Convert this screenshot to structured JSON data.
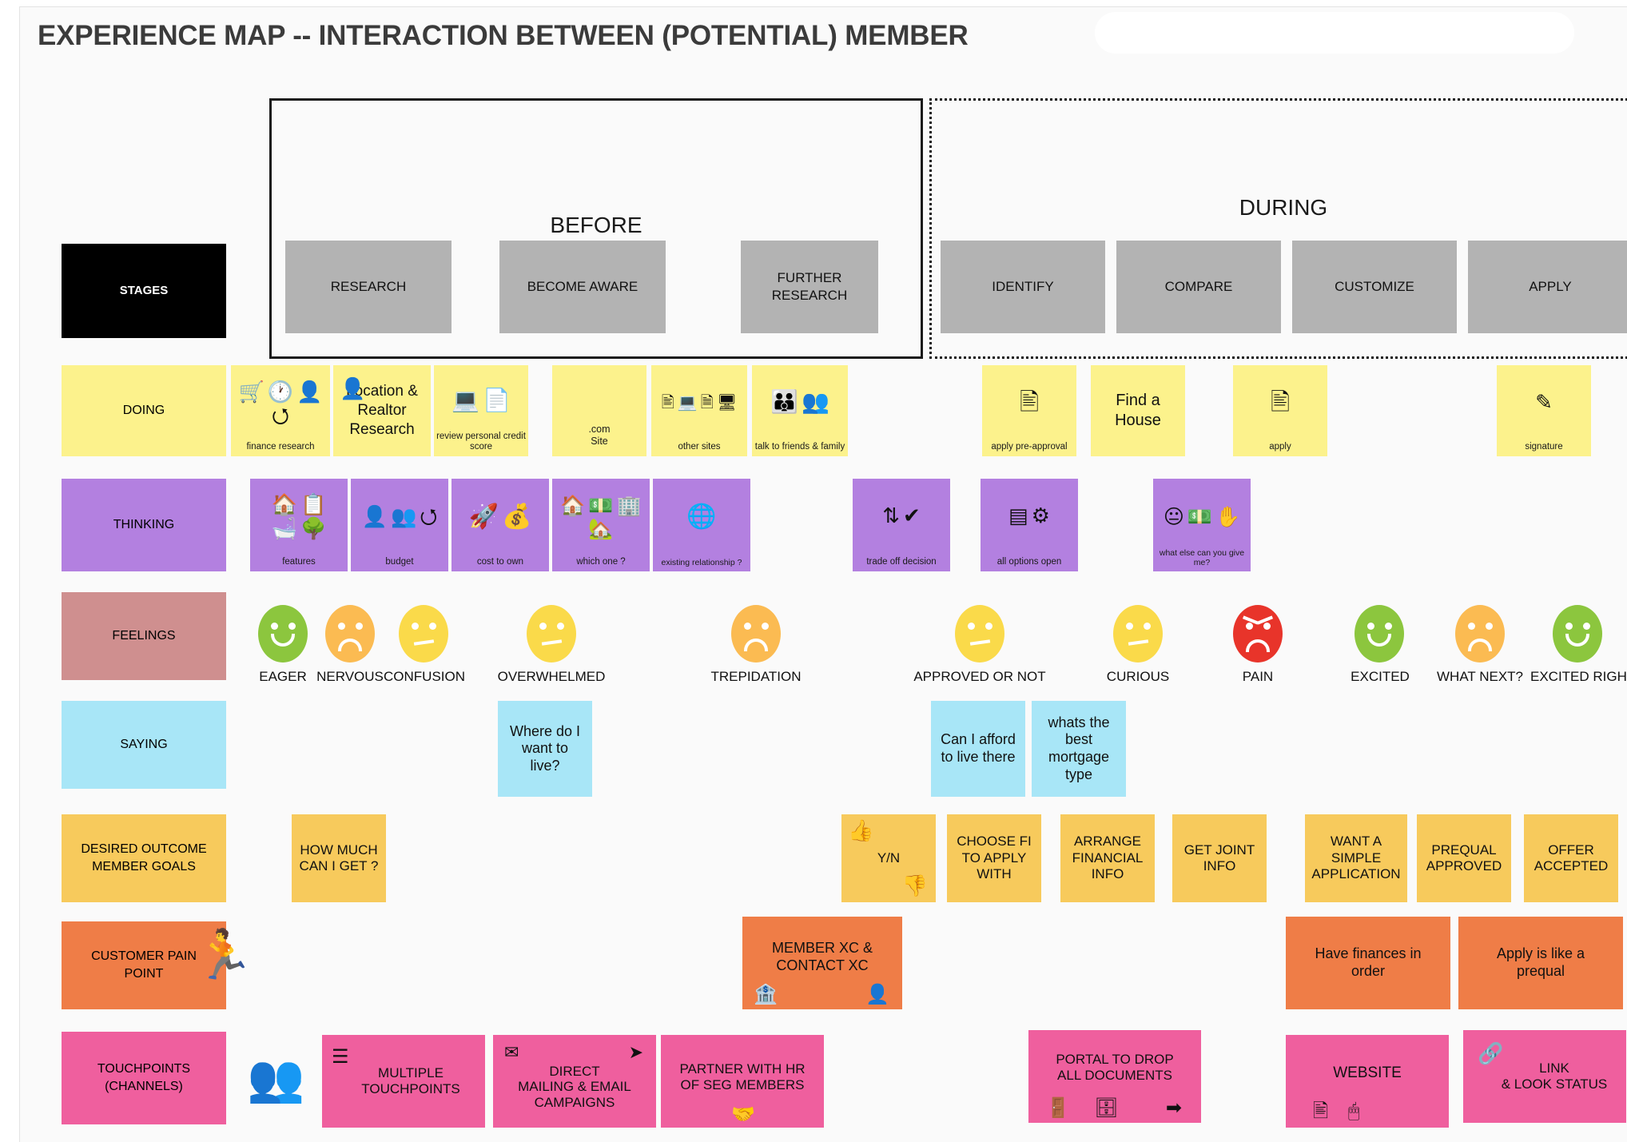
{
  "page": {
    "title": "EXPERIENCE MAP -- INTERACTION BETWEEN (POTENTIAL) MEMBER",
    "redacted_region_present": true
  },
  "phases": [
    {
      "id": "before",
      "label": "BEFORE",
      "border": "solid"
    },
    {
      "id": "during",
      "label": "DURING",
      "border": "dotted"
    }
  ],
  "row_labels": [
    {
      "id": "stages",
      "label": "STAGES",
      "color": "#000000",
      "text_color": "#ffffff"
    },
    {
      "id": "doing",
      "label": "DOING",
      "color": "#fcf28c",
      "text_color": "#111111"
    },
    {
      "id": "thinking",
      "label": "THINKING",
      "color": "#b380e0",
      "text_color": "#111111"
    },
    {
      "id": "feelings",
      "label": "FEELINGS",
      "color": "#cf8f8f",
      "text_color": "#111111"
    },
    {
      "id": "saying",
      "label": "SAYING",
      "color": "#a8e6f7",
      "text_color": "#111111"
    },
    {
      "id": "outcomes",
      "label": "DESIRED OUTCOME\nMEMBER GOALS",
      "color": "#f7ca5c",
      "text_color": "#111111"
    },
    {
      "id": "painpoint",
      "label": "CUSTOMER PAIN\nPOINT",
      "color": "#ef7d47",
      "text_color": "#111111"
    },
    {
      "id": "touch",
      "label": "TOUCHPOINTS\n(CHANNELS)",
      "color": "#ef5f9e",
      "text_color": "#111111"
    }
  ],
  "stages": [
    {
      "label": "RESEARCH",
      "phase": "before"
    },
    {
      "label": "BECOME AWARE",
      "phase": "before"
    },
    {
      "label": "FURTHER\nRESEARCH",
      "phase": "before"
    },
    {
      "label": "IDENTIFY",
      "phase": "during"
    },
    {
      "label": "COMPARE",
      "phase": "during"
    },
    {
      "label": "CUSTOMIZE",
      "phase": "during"
    },
    {
      "label": "APPLY",
      "phase": "during"
    }
  ],
  "doing": [
    {
      "caption": "finance research",
      "text": "",
      "icons": [
        "shopping-cart-icon",
        "clock-icon",
        "person-money-icon",
        "cycle-icon"
      ]
    },
    {
      "caption": "",
      "text": "Location &\nRealtor\nResearch",
      "icons": [
        "person-icon"
      ]
    },
    {
      "caption": "review personal credit score",
      "text": "",
      "icons": [
        "monitor-icon",
        "document-icon"
      ]
    },
    {
      "caption": ".com\nSite",
      "text": "",
      "icons": []
    },
    {
      "caption": "other sites",
      "text": "",
      "icons": [
        "webpage-icon",
        "www-laptop-icon",
        "browser-icon",
        "http-laptop-icon"
      ]
    },
    {
      "caption": "talk to friends & family",
      "text": "",
      "icons": [
        "family-icon",
        "people-icon"
      ]
    },
    {
      "caption": "apply pre-approval",
      "text": "",
      "icons": [
        "id-card-icon"
      ]
    },
    {
      "caption": "",
      "text": "Find a\nHouse",
      "icons": []
    },
    {
      "caption": "apply",
      "text": "",
      "icons": [
        "id-card-icon"
      ]
    },
    {
      "caption": "signature",
      "text": "",
      "icons": [
        "signature-icon"
      ]
    }
  ],
  "thinking": [
    {
      "caption": "features",
      "icons": [
        "house-icon",
        "checklist-icon",
        "bathtub-icon",
        "tree-fence-icon"
      ]
    },
    {
      "caption": "budget",
      "icons": [
        "person-money-icon",
        "people-group-icon",
        "cycle-icon"
      ]
    },
    {
      "caption": "cost to own",
      "icons": [
        "rocket-icon",
        "dollar-coin-icon"
      ]
    },
    {
      "caption": "which one ?",
      "icons": [
        "house-icon",
        "hand-money-icon",
        "building-icon",
        "home-icon"
      ]
    },
    {
      "caption": "existing relationship ?",
      "icons": [
        "globe-money-icon"
      ]
    },
    {
      "caption": "trade off decision",
      "icons": [
        "updown-arrow-hand-icon",
        "check-circle-icon"
      ]
    },
    {
      "caption": "all options open",
      "icons": [
        "sliders-icon",
        "equalizer-icon"
      ]
    },
    {
      "caption": "what else can you give me?",
      "icons": [
        "face-thinking-icon",
        "cash-stack-icon",
        "hand-icon"
      ]
    }
  ],
  "feelings": [
    {
      "label": "EAGER",
      "mood": "happy",
      "color": "#8cc63e"
    },
    {
      "label": "NERVOUS",
      "mood": "sad",
      "color": "#fbbb52"
    },
    {
      "label": "CONFUSION",
      "mood": "neutral",
      "color": "#fada4a"
    },
    {
      "label": "OVERWHELMED",
      "mood": "neutral",
      "color": "#fada4a"
    },
    {
      "label": "TREPIDATION",
      "mood": "sad",
      "color": "#fbbb52"
    },
    {
      "label": "APPROVED OR NOT",
      "mood": "neutral",
      "color": "#fada4a"
    },
    {
      "label": "CURIOUS",
      "mood": "neutral",
      "color": "#fada4a"
    },
    {
      "label": "PAIN",
      "mood": "angry",
      "color": "#e8342a"
    },
    {
      "label": "EXCITED",
      "mood": "happy",
      "color": "#8cc63e"
    },
    {
      "label": "WHAT NEXT?",
      "mood": "sad",
      "color": "#fbbb52"
    },
    {
      "label": "EXCITED RIGH",
      "mood": "happy",
      "color": "#8cc63e"
    }
  ],
  "saying": [
    {
      "text": "Where do I\nwant to\nlive?"
    },
    {
      "text": "Can I afford\nto live there"
    },
    {
      "text": "whats the\nbest\nmortgage\ntype"
    }
  ],
  "outcomes": [
    {
      "text": "HOW MUCH\nCAN I GET ?",
      "icons": []
    },
    {
      "text": "Y/N",
      "icons": [
        "thumbs-up-icon",
        "thumbs-down-icon"
      ]
    },
    {
      "text": "CHOOSE FI\nTO APPLY\nWITH",
      "icons": []
    },
    {
      "text": "ARRANGE\nFINANCIAL\nINFO",
      "icons": []
    },
    {
      "text": "GET JOINT\nINFO",
      "icons": []
    },
    {
      "text": "WANT A\nSIMPLE\nAPPLICATION",
      "icons": []
    },
    {
      "text": "PREQUAL\nAPPROVED",
      "icons": []
    },
    {
      "text": "OFFER\nACCEPTED",
      "icons": []
    }
  ],
  "painpoints": [
    {
      "text": "MEMBER XC &\nCONTACT XC",
      "icons": [
        "bank-icon",
        "person-icon"
      ]
    },
    {
      "text": "Have finances in\norder",
      "icons": []
    },
    {
      "text": "Apply is like a\nprequal",
      "icons": []
    }
  ],
  "touchpoints": [
    {
      "text": "MULTIPLE\nTOUCHPOINTS",
      "icons": [
        "stacked-funnel-icon"
      ]
    },
    {
      "text": "DIRECT\nMAILING & EMAIL\nCAMPAIGNS",
      "icons": [
        "envelope-icon",
        "paper-plane-icon"
      ]
    },
    {
      "text": "PARTNER WITH HR\nOF SEG MEMBERS",
      "icons": [
        "handshake-icon"
      ]
    },
    {
      "text": "PORTAL TO DROP\nALL DOCUMENTS",
      "icons": [
        "door-icon",
        "file-cabinet-icon",
        "login-icon"
      ]
    },
    {
      "text": "WEBSITE",
      "icons": [
        "browser-icon",
        "cursor-browser-icon"
      ]
    },
    {
      "text": "LINK\n& LOOK STATUS",
      "icons": [
        "chain-link-icon"
      ]
    }
  ],
  "decorations": [
    {
      "id": "network-people-icon",
      "row": "touchpoints"
    },
    {
      "id": "running-person-icon",
      "row": "painpoint"
    }
  ],
  "colors": {
    "yellow": "#fcf28c",
    "purple": "#b380e0",
    "blue": "#a8e6f7",
    "amber": "#f7ca5c",
    "orange": "#ef7d47",
    "pink": "#ef5f9e",
    "grey_chip": "#b3b3b3",
    "rose_label": "#cf8f8f",
    "black_label": "#000000",
    "canvas": "#fafafa"
  }
}
